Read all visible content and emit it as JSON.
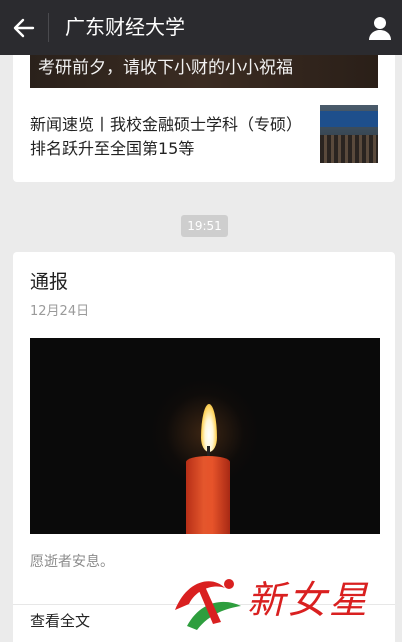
{
  "header": {
    "title": "广东财经大学",
    "back_icon": "back-arrow-icon",
    "profile_icon": "person-icon"
  },
  "feed_prev": {
    "banner_text": "考研前夕，请收下小财的小小祝福",
    "news_title": "新闻速览丨我校金融硕士学科（专硕）排名跃升至全国第15等"
  },
  "timestamp": "19:51",
  "post": {
    "title": "通报",
    "date": "12月24日",
    "excerpt": "愿逝者安息。",
    "read_more": "查看全文"
  },
  "watermark": {
    "text": "新女星"
  },
  "colors": {
    "topbar": "#2b2b2f",
    "background": "#ebebeb",
    "watermark_red": "#d92020",
    "watermark_green": "#2e9e3e"
  }
}
